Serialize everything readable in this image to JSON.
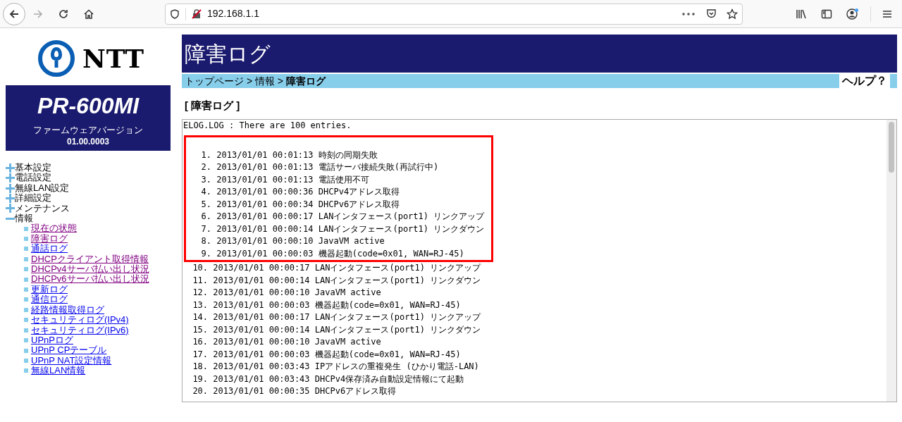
{
  "browser": {
    "url": "192.168.1.1"
  },
  "sidebar": {
    "logo_text": "NTT",
    "model": "PR-600MI",
    "firmware_label": "ファームウェアバージョン",
    "firmware_version": "01.00.0003",
    "menu": [
      {
        "label": "基本設定",
        "expanded": false
      },
      {
        "label": "電話設定",
        "expanded": false
      },
      {
        "label": "無線LAN設定",
        "expanded": false
      },
      {
        "label": "詳細設定",
        "expanded": false
      },
      {
        "label": "メンテナンス",
        "expanded": false
      },
      {
        "label": "情報",
        "expanded": true,
        "children": [
          {
            "label": "現在の状態",
            "visited": true
          },
          {
            "label": "障害ログ",
            "visited": true
          },
          {
            "label": "通話ログ",
            "visited": false
          },
          {
            "label": "DHCPクライアント取得情報",
            "visited": true
          },
          {
            "label": "DHCPv4サーバ払い出し状況",
            "visited": true
          },
          {
            "label": "DHCPv6サーバ払い出し状況",
            "visited": true
          },
          {
            "label": "更新ログ",
            "visited": false
          },
          {
            "label": "通信ログ",
            "visited": false
          },
          {
            "label": "経路情報取得ログ",
            "visited": false
          },
          {
            "label": "セキュリティログ(IPv4)",
            "visited": false
          },
          {
            "label": "セキュリティログ(IPv6)",
            "visited": false
          },
          {
            "label": "UPnPログ",
            "visited": false
          },
          {
            "label": "UPnP CPテーブル",
            "visited": false
          },
          {
            "label": "UPnP NAT設定情報",
            "visited": false
          },
          {
            "label": "無線LAN情報",
            "visited": false
          }
        ]
      }
    ]
  },
  "main": {
    "title": "障害ログ",
    "breadcrumb": "トップページ > 情報 > **障害ログ**",
    "help": "ヘルプ？",
    "heading": "[ 障害ログ ]",
    "log": {
      "header": "ELOG.LOG : There are 100 entries.",
      "highlighted_entries": [
        "1. 2013/01/01 00:01:13 時刻の同期失敗",
        "2. 2013/01/01 00:01:13 電話サーバ接続失敗(再試行中)",
        "3. 2013/01/01 00:01:13 電話使用不可",
        "4. 2013/01/01 00:00:36 DHCPv4アドレス取得",
        "5. 2013/01/01 00:00:34 DHCPv6アドレス取得",
        "6. 2013/01/01 00:00:17 LANインタフェース(port1) リンクアップ",
        "7. 2013/01/01 00:00:14 LANインタフェース(port1) リンクダウン",
        "8. 2013/01/01 00:00:10 JavaVM active",
        "9. 2013/01/01 00:00:03 機器起動(code=0x01, WAN=RJ-45)"
      ],
      "entries": [
        "10. 2013/01/01 00:00:17 LANインタフェース(port1) リンクアップ",
        "11. 2013/01/01 00:00:14 LANインタフェース(port1) リンクダウン",
        "12. 2013/01/01 00:00:10 JavaVM active",
        "13. 2013/01/01 00:00:03 機器起動(code=0x01, WAN=RJ-45)",
        "14. 2013/01/01 00:00:17 LANインタフェース(port1) リンクアップ",
        "15. 2013/01/01 00:00:14 LANインタフェース(port1) リンクダウン",
        "16. 2013/01/01 00:00:10 JavaVM active",
        "17. 2013/01/01 00:00:03 機器起動(code=0x01, WAN=RJ-45)",
        "18. 2013/01/01 00:03:43 IPアドレスの重複発生 (ひかり電話-LAN)",
        "19. 2013/01/01 00:03:43 DHCPv4保存済み自動設定情報にて起動",
        "20. 2013/01/01 00:00:35 DHCPv6アドレス取得"
      ]
    }
  }
}
